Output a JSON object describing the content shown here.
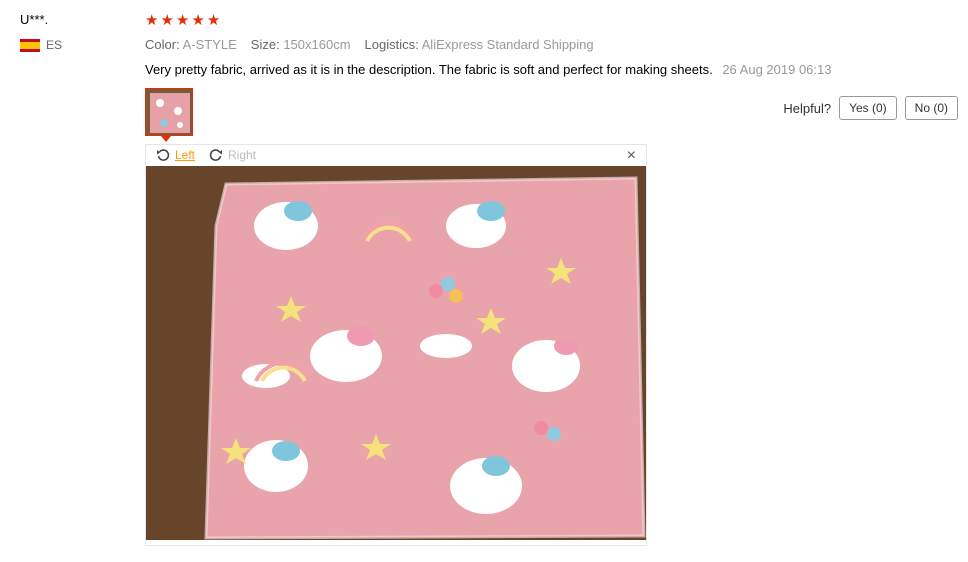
{
  "review": {
    "user": "U***.",
    "country_code": "ES",
    "flag_colors": [
      "#c60b1e",
      "#ffc400"
    ],
    "rating": 5,
    "star_glyph": "★",
    "specs": {
      "color_label": "Color:",
      "color_value": "A-STYLE",
      "size_label": "Size:",
      "size_value": "150x160cm",
      "logistics_label": "Logistics:",
      "logistics_value": "AliExpress Standard Shipping"
    },
    "text": "Very pretty fabric, arrived as it is in the description. The fabric is soft and perfect for making sheets.",
    "date": "26 Aug 2019 06:13"
  },
  "helpful": {
    "label": "Helpful?",
    "yes": "Yes (0)",
    "no": "No (0)"
  },
  "viewer": {
    "rotate_left": "Left",
    "rotate_right": "Right",
    "close_icon": "×"
  },
  "colors": {
    "accent": "#e62e04",
    "rotate_active": "#ff9900"
  }
}
